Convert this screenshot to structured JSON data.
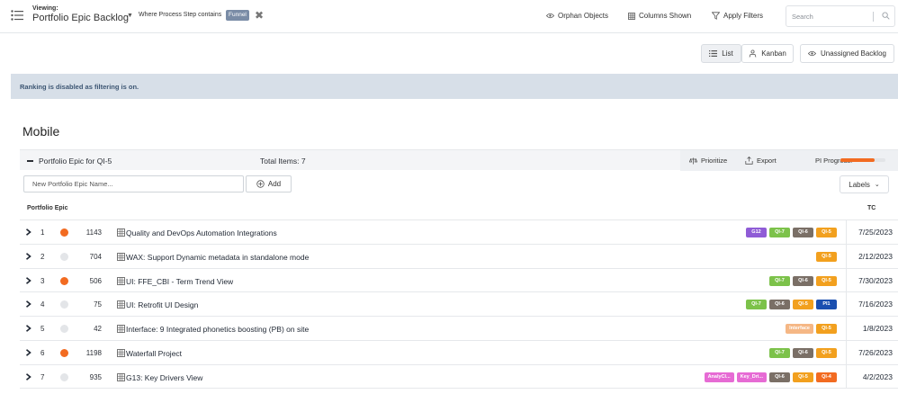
{
  "header": {
    "viewing_label": "Viewing:",
    "view_title": "Portfolio Epic Backlog",
    "filter_text": "Where Process Step contains",
    "filter_chip": "Funnel",
    "orphan_objects": "Orphan Objects",
    "columns_shown": "Columns Shown",
    "apply_filters": "Apply Filters",
    "search_placeholder": "Search"
  },
  "view_toggle": {
    "list": "List",
    "kanban": "Kanban",
    "unassigned": "Unassigned Backlog"
  },
  "banner": {
    "text": "Ranking is disabled as filtering is on."
  },
  "section": {
    "title": "Mobile",
    "group_title": "Portfolio Epic for  QI-5",
    "total_items": "Total Items: 7",
    "prioritize": "Prioritize",
    "export": "Export",
    "pi_progress_label": "PI Progress:",
    "pi_progress_fraction": 0.76
  },
  "new_item": {
    "placeholder": "New Portfolio Epic Name...",
    "add_label": "Add",
    "labels_button": "Labels"
  },
  "columns": {
    "portfolio_epic": "Portfolio Epic",
    "tc": "TC"
  },
  "colors": {
    "accent_orange": "#f26b21",
    "dot_empty": "#e3e5e8",
    "banner_bg": "#d7dfe8",
    "chip_g12": "#8f5cd6",
    "chip_qi7": "#7cc24a",
    "chip_qi6": "#7a6f66",
    "chip_qi5": "#f2a01e",
    "chip_pi1": "#1a4fb0",
    "chip_interface": "#f5b785",
    "chip_pink": "#e66bd4",
    "chip_qi4": "#f26b21"
  },
  "rows": [
    {
      "num": "1",
      "status": "active",
      "id": "1143",
      "name": "Quality and DevOps Automation Integrations",
      "labels": [
        {
          "text": "G12",
          "color": "#8f5cd6"
        },
        {
          "text": "QI-7",
          "color": "#7cc24a"
        },
        {
          "text": "QI-6",
          "color": "#7a6f66"
        },
        {
          "text": "QI-5",
          "color": "#f2a01e"
        }
      ],
      "tc": "7/25/2023"
    },
    {
      "num": "2",
      "status": "empty",
      "id": "704",
      "name": "WAX: Support Dynamic metadata in standalone mode",
      "labels": [
        {
          "text": "QI-5",
          "color": "#f2a01e"
        }
      ],
      "tc": "2/12/2023"
    },
    {
      "num": "3",
      "status": "active",
      "id": "506",
      "name": "UI: FFE_CBI - Term Trend View",
      "labels": [
        {
          "text": "QI-7",
          "color": "#7cc24a"
        },
        {
          "text": "QI-6",
          "color": "#7a6f66"
        },
        {
          "text": "QI-5",
          "color": "#f2a01e"
        }
      ],
      "tc": "7/30/2023"
    },
    {
      "num": "4",
      "status": "empty",
      "id": "75",
      "name": "UI: Retrofit UI Design",
      "labels": [
        {
          "text": "QI-7",
          "color": "#7cc24a"
        },
        {
          "text": "QI-6",
          "color": "#7a6f66"
        },
        {
          "text": "QI-5",
          "color": "#f2a01e"
        },
        {
          "text": "PI1",
          "color": "#1a4fb0"
        }
      ],
      "tc": "7/16/2023"
    },
    {
      "num": "5",
      "status": "empty",
      "id": "42",
      "name": "Interface: 9 Integrated phonetics boosting (PB) on site",
      "labels": [
        {
          "text": "Interface",
          "color": "#f5b785"
        },
        {
          "text": "QI-5",
          "color": "#f2a01e"
        }
      ],
      "tc": "1/8/2023"
    },
    {
      "num": "6",
      "status": "active",
      "id": "1198",
      "name": "Waterfall Project",
      "labels": [
        {
          "text": "QI-7",
          "color": "#7cc24a"
        },
        {
          "text": "QI-6",
          "color": "#7a6f66"
        },
        {
          "text": "QI-5",
          "color": "#f2a01e"
        }
      ],
      "tc": "7/26/2023"
    },
    {
      "num": "7",
      "status": "empty",
      "id": "935",
      "name": "G13: Key Drivers View",
      "labels": [
        {
          "text": "AnalyCl...",
          "color": "#e66bd4"
        },
        {
          "text": "Key_Dri...",
          "color": "#e66bd4"
        },
        {
          "text": "QI-6",
          "color": "#7a6f66"
        },
        {
          "text": "QI-5",
          "color": "#f2a01e"
        },
        {
          "text": "QI-4",
          "color": "#f26b21"
        }
      ],
      "tc": "4/2/2023"
    }
  ]
}
